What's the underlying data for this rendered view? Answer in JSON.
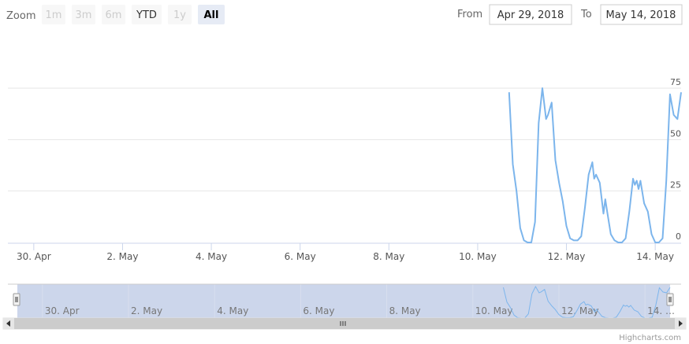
{
  "range_selector": {
    "zoom_label": "Zoom",
    "buttons": [
      {
        "label": "1m",
        "state": "disabled"
      },
      {
        "label": "3m",
        "state": "disabled"
      },
      {
        "label": "6m",
        "state": "disabled"
      },
      {
        "label": "YTD",
        "state": "enabled"
      },
      {
        "label": "1y",
        "state": "disabled"
      },
      {
        "label": "All",
        "state": "active"
      }
    ],
    "from_label": "From",
    "from_value": "Apr 29, 2018",
    "to_label": "To",
    "to_value": "May 14, 2018"
  },
  "chart_data": {
    "type": "line",
    "x_axis": {
      "type": "datetime",
      "range": [
        "2018-04-29T10:00",
        "2018-05-14T14:00"
      ],
      "tick_labels": [
        {
          "date": "2018-04-30",
          "label": "30. Apr"
        },
        {
          "date": "2018-05-02",
          "label": "2. May"
        },
        {
          "date": "2018-05-04",
          "label": "4. May"
        },
        {
          "date": "2018-05-06",
          "label": "6. May"
        },
        {
          "date": "2018-05-08",
          "label": "8. May"
        },
        {
          "date": "2018-05-10",
          "label": "10. May"
        },
        {
          "date": "2018-05-12",
          "label": "12. May"
        },
        {
          "date": "2018-05-14",
          "label": "14. May"
        }
      ]
    },
    "y_axis": {
      "range": [
        0,
        75
      ],
      "ticks": [
        0,
        25,
        50,
        75
      ],
      "opposite": true,
      "grid": true
    },
    "series": [
      {
        "color": "#7cb5ec",
        "points": [
          [
            "2018-05-10T17:00",
            73
          ],
          [
            "2018-05-10T19:00",
            38
          ],
          [
            "2018-05-10T21:00",
            25
          ],
          [
            "2018-05-10T23:00",
            7
          ],
          [
            "2018-05-11T01:00",
            1
          ],
          [
            "2018-05-11T03:00",
            0
          ],
          [
            "2018-05-11T05:00",
            0
          ],
          [
            "2018-05-11T07:00",
            10
          ],
          [
            "2018-05-11T09:00",
            58
          ],
          [
            "2018-05-11T11:00",
            75
          ],
          [
            "2018-05-11T13:00",
            60
          ],
          [
            "2018-05-11T14:00",
            62
          ],
          [
            "2018-05-11T16:00",
            68
          ],
          [
            "2018-05-11T18:00",
            40
          ],
          [
            "2018-05-11T20:00",
            29
          ],
          [
            "2018-05-11T22:00",
            20
          ],
          [
            "2018-05-12T00:00",
            8
          ],
          [
            "2018-05-12T02:00",
            2
          ],
          [
            "2018-05-12T04:00",
            1
          ],
          [
            "2018-05-12T06:00",
            1
          ],
          [
            "2018-05-12T08:00",
            3
          ],
          [
            "2018-05-12T10:00",
            17
          ],
          [
            "2018-05-12T12:00",
            33
          ],
          [
            "2018-05-12T14:00",
            39
          ],
          [
            "2018-05-12T15:00",
            31
          ],
          [
            "2018-05-12T16:00",
            33
          ],
          [
            "2018-05-12T18:00",
            29
          ],
          [
            "2018-05-12T20:00",
            14
          ],
          [
            "2018-05-12T21:00",
            21
          ],
          [
            "2018-05-12T22:00",
            15
          ],
          [
            "2018-05-13T00:00",
            4
          ],
          [
            "2018-05-13T02:00",
            1
          ],
          [
            "2018-05-13T04:00",
            0
          ],
          [
            "2018-05-13T06:00",
            0
          ],
          [
            "2018-05-13T08:00",
            2
          ],
          [
            "2018-05-13T10:00",
            15
          ],
          [
            "2018-05-13T12:00",
            31
          ],
          [
            "2018-05-13T13:00",
            28
          ],
          [
            "2018-05-13T14:00",
            30
          ],
          [
            "2018-05-13T15:00",
            26
          ],
          [
            "2018-05-13T16:00",
            30
          ],
          [
            "2018-05-13T18:00",
            19
          ],
          [
            "2018-05-13T20:00",
            15
          ],
          [
            "2018-05-13T22:00",
            4
          ],
          [
            "2018-05-14T00:00",
            0
          ],
          [
            "2018-05-14T02:00",
            0
          ],
          [
            "2018-05-14T04:00",
            2
          ],
          [
            "2018-05-14T06:00",
            30
          ],
          [
            "2018-05-14T08:00",
            72
          ],
          [
            "2018-05-14T10:00",
            62
          ],
          [
            "2018-05-14T12:00",
            60
          ],
          [
            "2018-05-14T14:00",
            73
          ]
        ]
      }
    ]
  },
  "navigator": {
    "range": [
      "2018-04-29T10:00",
      "2018-05-14T14:00"
    ],
    "selected": [
      "2018-04-29T10:00",
      "2018-05-14T14:00"
    ],
    "tick_labels": [
      {
        "date": "2018-04-30",
        "label": "30. Apr"
      },
      {
        "date": "2018-05-02",
        "label": "2. May"
      },
      {
        "date": "2018-05-04",
        "label": "4. May"
      },
      {
        "date": "2018-05-06",
        "label": "6. May"
      },
      {
        "date": "2018-05-08",
        "label": "8. May"
      },
      {
        "date": "2018-05-10",
        "label": "10. May"
      },
      {
        "date": "2018-05-12",
        "label": "12. May"
      },
      {
        "date": "2018-05-14",
        "label": "14. …"
      }
    ],
    "fill_color": "#ccd6eb"
  },
  "credits": "Highcharts.com"
}
